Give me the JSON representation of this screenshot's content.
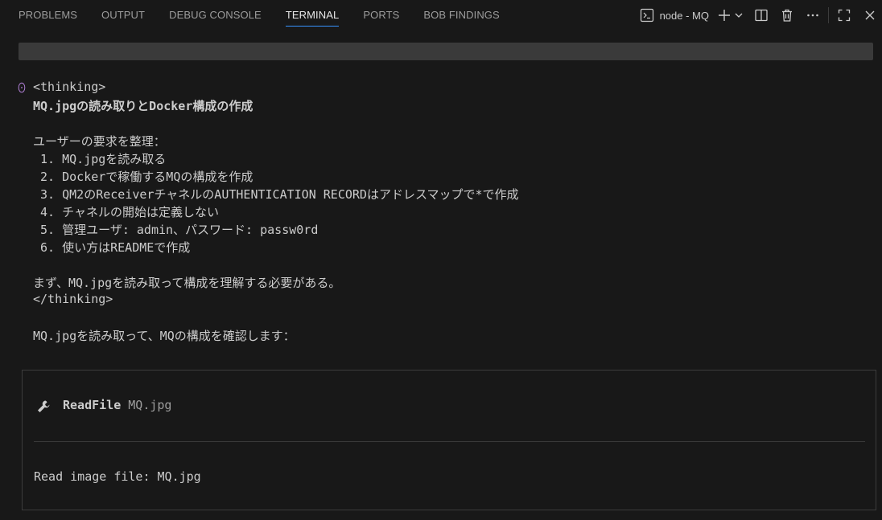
{
  "tabs": [
    {
      "label": "PROBLEMS"
    },
    {
      "label": "OUTPUT"
    },
    {
      "label": "DEBUG CONSOLE"
    },
    {
      "label": "TERMINAL",
      "active": true
    },
    {
      "label": "PORTS"
    },
    {
      "label": "BOB FINDINGS"
    }
  ],
  "terminal": {
    "name": "node - MQ",
    "icons": [
      "terminal-icon",
      "plus-icon",
      "chevron-down-icon",
      "split-icon",
      "trash-icon",
      "more-icon",
      "maximize-icon",
      "close-icon"
    ]
  },
  "output": {
    "thinking_open": "<thinking>",
    "heading": "MQ.jpgの読み取りとDocker構成の作成",
    "intro": "ユーザーの要求を整理：",
    "items": [
      " 1. MQ.jpgを読み取る",
      " 2. Dockerで稼働するMQの構成を作成",
      " 3. QM2のReceiverチャネルのAUTHENTICATION RECORDはアドレスマップで*で作成",
      " 4. チャネルの開始は定義しない",
      " 5. 管理ユーザ: admin、パスワード: passw0rd",
      " 6. 使い方はREADMEで作成"
    ],
    "plan": "まず、MQ.jpgを読み取って構成を理解する必要がある。",
    "thinking_close": "</thinking>",
    "message": "MQ.jpgを読み取って、MQの構成を確認します："
  },
  "tool": {
    "name": "ReadFile",
    "arg": "MQ.jpg",
    "result": "Read image file: MQ.jpg"
  },
  "colors": {
    "background": "#181818",
    "text": "#cccccc",
    "active_tab_underline": "#3794ff",
    "gutter_icon": "#b180d7"
  }
}
